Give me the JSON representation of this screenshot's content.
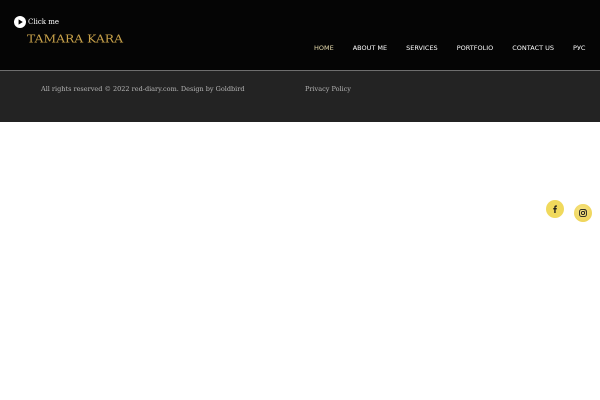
{
  "header": {
    "click_label": "Click me",
    "logo_text": "TAMARA KARA"
  },
  "nav": {
    "items": [
      {
        "label": "HOME",
        "active": true
      },
      {
        "label": "ABOUT ME",
        "active": false
      },
      {
        "label": "SERVICES",
        "active": false
      },
      {
        "label": "PORTFOLIO",
        "active": false
      },
      {
        "label": "CONTACT US",
        "active": false
      },
      {
        "label": "РУС",
        "active": false
      }
    ]
  },
  "footer": {
    "copyright": "All rights reserved © 2022 red-diary.com. Design by Goldbird",
    "privacy_label": "Privacy Policy"
  },
  "social": {
    "items": [
      {
        "icon": "facebook-icon"
      },
      {
        "icon": "instagram-icon"
      }
    ]
  },
  "colors": {
    "header_bg": "#050505",
    "footer_bg": "#232323",
    "accent_gold": "#c9a24a",
    "social_bg": "#f0d95c"
  }
}
